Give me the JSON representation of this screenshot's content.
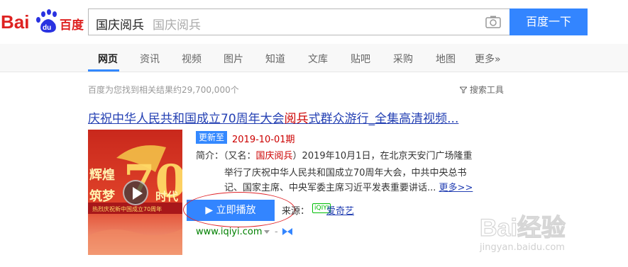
{
  "header": {
    "logo_text": "Bai百度",
    "logo_paw": "du",
    "search_value": "国庆阅兵",
    "search_suggest": "国庆阅兵",
    "search_button": "百度一下"
  },
  "nav": {
    "tabs": [
      {
        "label": "网页",
        "active": true
      },
      {
        "label": "资讯"
      },
      {
        "label": "视频"
      },
      {
        "label": "图片"
      },
      {
        "label": "知道"
      },
      {
        "label": "文库"
      },
      {
        "label": "贴吧"
      },
      {
        "label": "采购"
      },
      {
        "label": "地图"
      },
      {
        "label": "更多»"
      }
    ]
  },
  "results_info": {
    "stats": "百度为您找到相关结果约29,700,000个",
    "tools": "搜索工具"
  },
  "result": {
    "title_pre": "庆祝中华人民共和国成立70周年大会",
    "title_hl": "阅兵",
    "title_post": "式群众游行_全集高清视频...",
    "update_badge": "更新至",
    "update_date": "2019-10-01期",
    "desc_label": "简介：",
    "desc_line1_pre": "（又名：",
    "desc_line1_hl": "国庆阅兵",
    "desc_line1_post": "）2019年10月1日，在北京天安门广场隆重",
    "desc_line2": "举行了庆祝中华人民共和国成立70周年大会，中共中央总书",
    "desc_line3": "记、国家主席、中央军委主席习近平发表重要讲话...",
    "more_link": "更多>>",
    "play_button": "▶ 立即播放",
    "source_label": "来源：",
    "source_badge": "iQIYI",
    "source_name": "爱奇艺",
    "url": "www.iqiyi.com",
    "url_dash": "-",
    "thumb_caption": "热烈庆祝新中国成立70周年"
  },
  "watermark": {
    "brand": "Bai经验",
    "site": "jingyan.baidu.com"
  },
  "colors": {
    "brand_blue": "#3385ff",
    "link_blue": "#2440b3",
    "highlight_red": "#cc0000",
    "url_green": "#008000"
  }
}
